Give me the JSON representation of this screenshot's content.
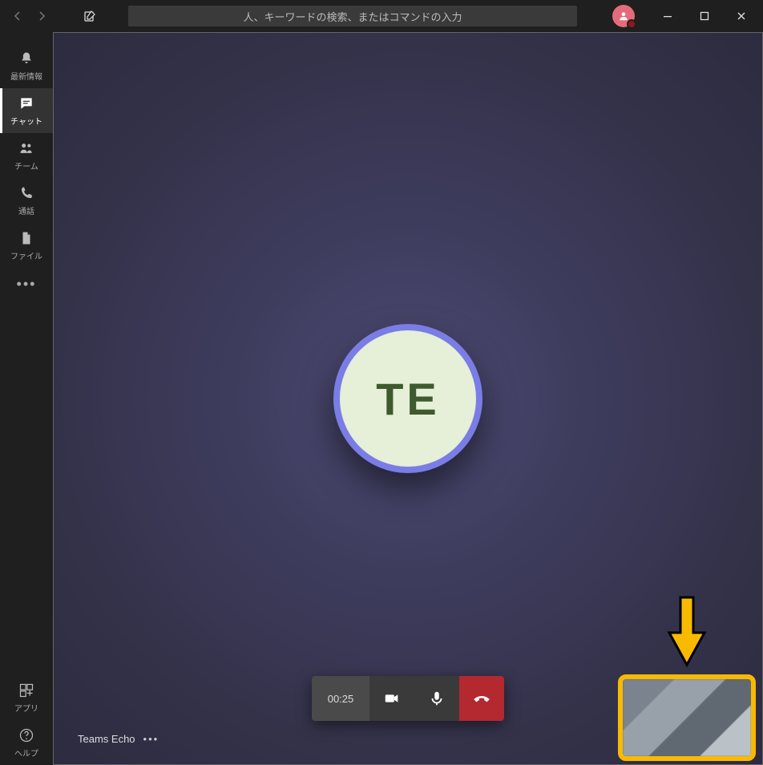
{
  "titlebar": {
    "search_placeholder": "人、キーワードの検索、またはコマンドの入力"
  },
  "sidebar": {
    "items": [
      {
        "label": "最新情報",
        "icon": "bell-icon"
      },
      {
        "label": "チャット",
        "icon": "chat-icon"
      },
      {
        "label": "チーム",
        "icon": "teams-icon"
      },
      {
        "label": "通話",
        "icon": "call-icon"
      },
      {
        "label": "ファイル",
        "icon": "file-icon"
      }
    ],
    "apps_label": "アプリ",
    "help_label": "ヘルプ"
  },
  "call": {
    "contact_initials": "TE",
    "duration": "00:25",
    "contact_name": "Teams Echo"
  }
}
